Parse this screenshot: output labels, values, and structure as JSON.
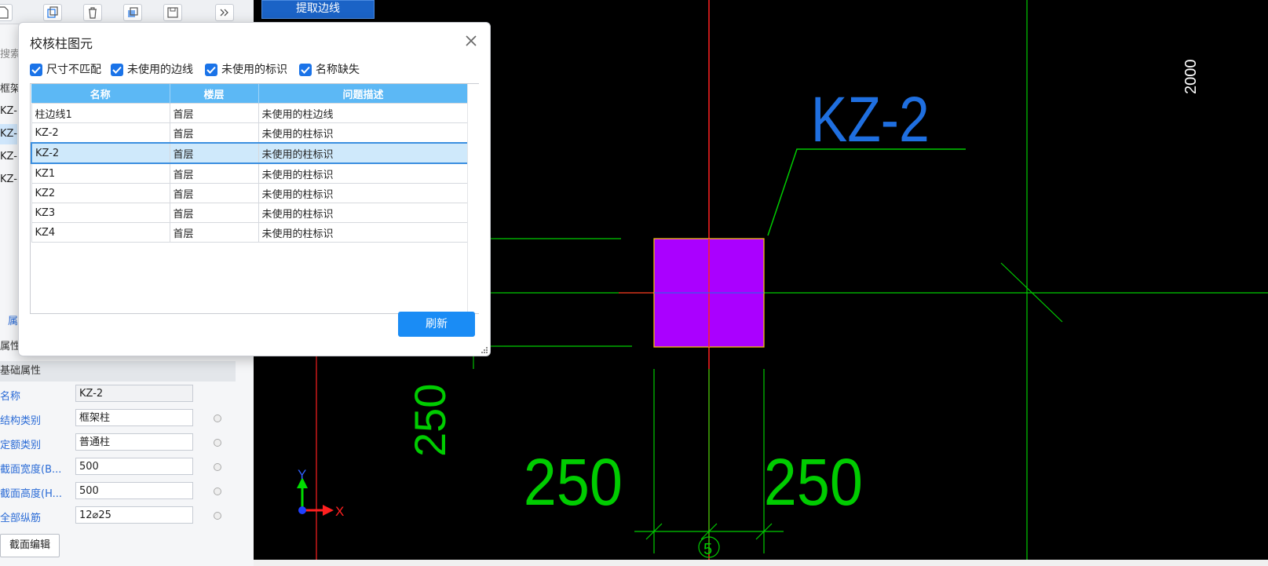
{
  "left_panel": {
    "search_hint": "搜索",
    "tree_header": "框架柱",
    "tree_items": [
      "KZ-",
      "KZ-",
      "KZ-",
      "KZ-"
    ],
    "props_tab": "属",
    "props_header": "属性",
    "props_section": "基础属性",
    "properties": [
      {
        "label": "名称",
        "value": "KZ-2"
      },
      {
        "label": "结构类别",
        "value": "框架柱"
      },
      {
        "label": "定额类别",
        "value": "普通柱"
      },
      {
        "label": "截面宽度(B...",
        "value": "500"
      },
      {
        "label": "截面高度(H...",
        "value": "500"
      },
      {
        "label": "全部纵筋",
        "value": "12⌀25"
      }
    ],
    "section_edit_label": "截面编辑"
  },
  "toolbar": {
    "icons": [
      "new-file-icon",
      "copy-icon",
      "delete-icon",
      "layer-copy-icon",
      "save-icon",
      "fast-forward-icon"
    ]
  },
  "canvas": {
    "extract_edge_label": "提取边线",
    "column_label": "KZ-2",
    "dim_right_vertical": "2000",
    "dim_left_vertical": "250",
    "dim_bottom_left": "250",
    "dim_bottom_right": "250",
    "axis_number": "5",
    "axis_x": "X",
    "axis_y": "Y",
    "colors": {
      "background": "#000000",
      "column_fill": "#aa00ff",
      "column_outline": "#ffcc00",
      "green_lines": "#00cc00",
      "red_lines": "#ff2020",
      "label_blue": "#1f6fe0"
    }
  },
  "dialog": {
    "title": "校核柱图元",
    "filters": [
      {
        "label": "尺寸不匹配",
        "checked": true
      },
      {
        "label": "未使用的边线",
        "checked": true
      },
      {
        "label": "未使用的标识",
        "checked": true
      },
      {
        "label": "名称缺失",
        "checked": true
      }
    ],
    "columns": [
      "名称",
      "楼层",
      "问题描述"
    ],
    "rows": [
      {
        "name": "柱边线1",
        "floor": "首层",
        "desc": "未使用的柱边线"
      },
      {
        "name": "KZ-2",
        "floor": "首层",
        "desc": "未使用的柱标识"
      },
      {
        "name": "KZ-2",
        "floor": "首层",
        "desc": "未使用的柱标识",
        "selected": true
      },
      {
        "name": "KZ1",
        "floor": "首层",
        "desc": "未使用的柱标识"
      },
      {
        "name": "KZ2",
        "floor": "首层",
        "desc": "未使用的柱标识"
      },
      {
        "name": "KZ3",
        "floor": "首层",
        "desc": "未使用的柱标识"
      },
      {
        "name": "KZ4",
        "floor": "首层",
        "desc": "未使用的柱标识"
      }
    ],
    "refresh_label": "刷新",
    "accent_color": "#1a8cf5",
    "header_color": "#5cb8f5"
  }
}
